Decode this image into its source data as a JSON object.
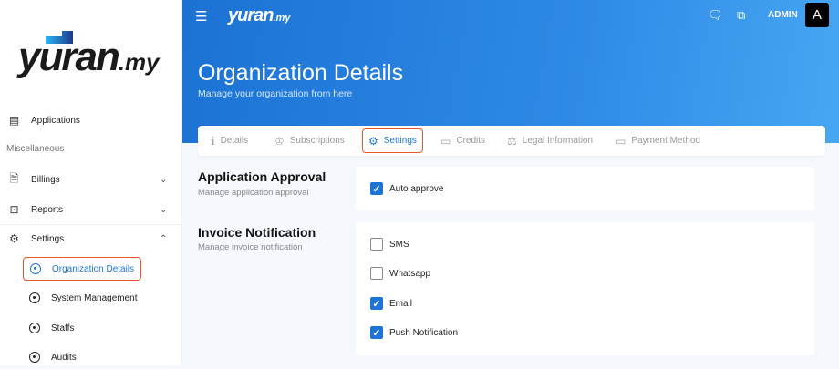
{
  "brand": {
    "name": "yuran",
    "suffix": ".my"
  },
  "sidebar": {
    "applications": "Applications",
    "section": "Miscellaneous",
    "billings": "Billings",
    "reports": "Reports",
    "settings": "Settings",
    "sub": [
      "Organization Details",
      "System Management",
      "Staffs",
      "Audits"
    ]
  },
  "header": {
    "admin": "ADMIN",
    "avatar": "A",
    "title": "Organization Details",
    "subtitle": "Manage your organization from here"
  },
  "tabs": [
    "Details",
    "Subscriptions",
    "Settings",
    "Credits",
    "Legal Information",
    "Payment Method"
  ],
  "sections": {
    "approval": {
      "title": "Application Approval",
      "desc": "Manage application approval",
      "options": [
        {
          "label": "Auto approve",
          "checked": true
        }
      ]
    },
    "invoice": {
      "title": "Invoice Notification",
      "desc": "Manage invoice notification",
      "options": [
        {
          "label": "SMS",
          "checked": false
        },
        {
          "label": "Whatsapp",
          "checked": false
        },
        {
          "label": "Email",
          "checked": true
        },
        {
          "label": "Push Notification",
          "checked": true
        }
      ]
    }
  }
}
